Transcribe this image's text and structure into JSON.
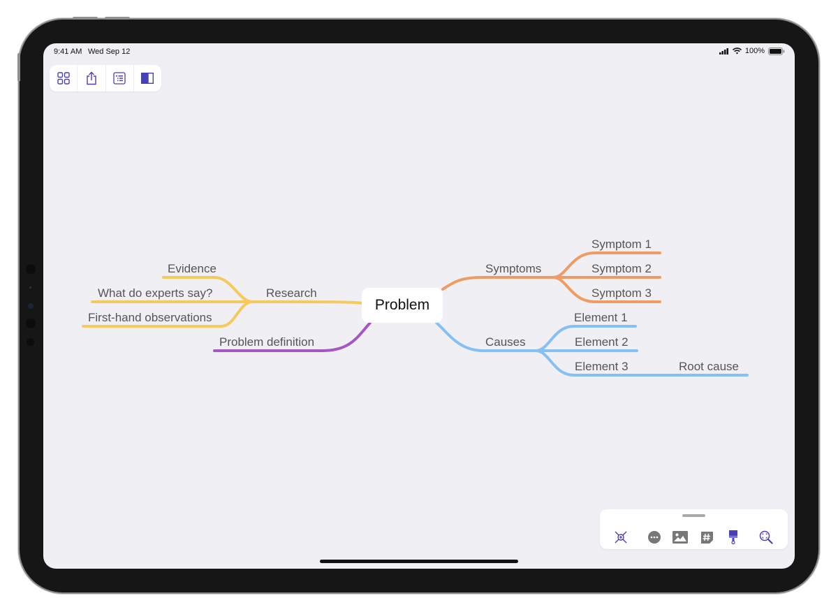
{
  "status_bar": {
    "time": "9:41 AM",
    "date": "Wed Sep 12",
    "battery": "100%",
    "icons": [
      "signal-icon",
      "wifi-icon",
      "battery-icon"
    ]
  },
  "top_toolbar": {
    "buttons": [
      {
        "name": "grid-view",
        "icon": "grid-icon"
      },
      {
        "name": "share",
        "icon": "share-icon"
      },
      {
        "name": "outline",
        "icon": "outline-list-icon"
      },
      {
        "name": "sidebar",
        "icon": "sidebar-icon"
      }
    ]
  },
  "mindmap": {
    "center": "Problem",
    "branches": {
      "research": {
        "label": "Research",
        "color": "#f5c95a",
        "children": [
          "Evidence",
          "What do experts say?",
          "First-hand observations"
        ]
      },
      "problem_definition": {
        "label": "Problem definition",
        "color": "#a457c3"
      },
      "symptoms": {
        "label": "Symptoms",
        "color": "#ee9c65",
        "children": [
          "Symptom 1",
          "Symptom 2",
          "Symptom 3"
        ]
      },
      "causes": {
        "label": "Causes",
        "color": "#86c0f2",
        "children": [
          "Element 1",
          "Element 2",
          "Element 3"
        ],
        "sub": {
          "Element 3": "Root cause"
        }
      }
    }
  },
  "bottom_toolbar": {
    "buttons": [
      {
        "name": "focus",
        "icon": "focus-node-icon"
      },
      {
        "name": "more",
        "icon": "more-icon"
      },
      {
        "name": "image",
        "icon": "image-icon"
      },
      {
        "name": "tag",
        "icon": "hashtag-icon"
      },
      {
        "name": "style",
        "icon": "paintbrush-icon"
      },
      {
        "name": "zoom-fit",
        "icon": "zoom-fit-icon"
      }
    ]
  },
  "colors": {
    "accent": "#4a40b5",
    "canvas": "#efeff4"
  }
}
